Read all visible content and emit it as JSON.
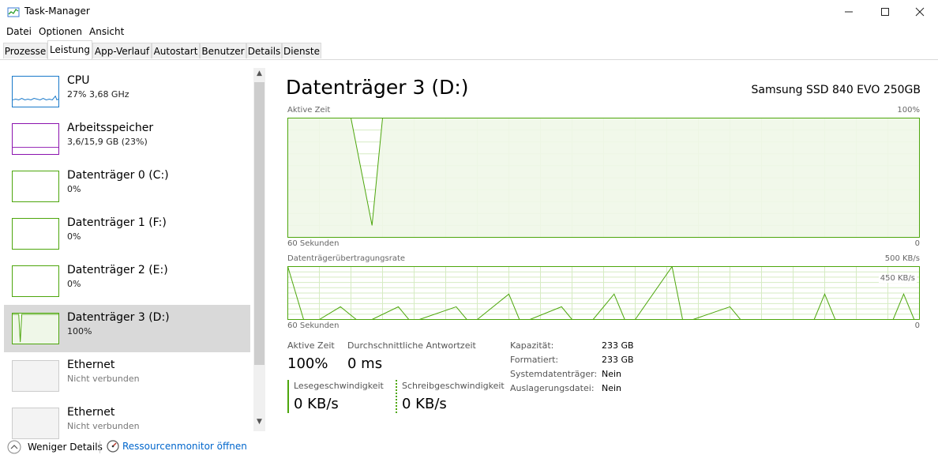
{
  "window": {
    "title": "Task-Manager"
  },
  "menu": [
    "Datei",
    "Optionen",
    "Ansicht"
  ],
  "tabs": [
    "Prozesse",
    "Leistung",
    "App-Verlauf",
    "Autostart",
    "Benutzer",
    "Details",
    "Dienste"
  ],
  "active_tab": "Leistung",
  "sidebar": [
    {
      "name": "CPU",
      "sub": "27% 3,68 GHz",
      "color": "#1979ca"
    },
    {
      "name": "Arbeitsspeicher",
      "sub": "3,6/15,9 GB (23%)",
      "color": "#8b12ae"
    },
    {
      "name": "Datenträger 0 (C:)",
      "sub": "0%",
      "color": "#4da60c"
    },
    {
      "name": "Datenträger 1 (F:)",
      "sub": "0%",
      "color": "#4da60c"
    },
    {
      "name": "Datenträger 2 (E:)",
      "sub": "0%",
      "color": "#4da60c"
    },
    {
      "name": "Datenträger 3 (D:)",
      "sub": "100%",
      "color": "#4da60c"
    },
    {
      "name": "Ethernet",
      "sub": "Nicht verbunden",
      "color": "#cccccc"
    },
    {
      "name": "Ethernet",
      "sub": "Nicht verbunden",
      "color": "#cccccc"
    }
  ],
  "main": {
    "title": "Datenträger 3 (D:)",
    "model": "Samsung SSD 840 EVO 250GB",
    "chart1": {
      "label": "Aktive Zeit",
      "max": "100%",
      "left_bottom": "60 Sekunden",
      "right_bottom": "0"
    },
    "chart2": {
      "label": "Datenträgerübertragungsrate",
      "max": "500 KB/s",
      "inner": "450 KB/s",
      "left_bottom": "60 Sekunden",
      "right_bottom": "0"
    },
    "stats": {
      "active_label": "Aktive Zeit",
      "active_value": "100%",
      "response_label": "Durchschnittliche Antwortzeit",
      "response_value": "0 ms",
      "read_label": "Lesegeschwindigkeit",
      "read_value": "0 KB/s",
      "write_label": "Schreibgeschwindigkeit",
      "write_value": "0 KB/s"
    },
    "props": [
      {
        "key": "Kapazität:",
        "value": "233 GB"
      },
      {
        "key": "Formatiert:",
        "value": "233 GB"
      },
      {
        "key": "Systemdatenträger:",
        "value": "Nein"
      },
      {
        "key": "Auslagerungsdatei:",
        "value": "Nein"
      }
    ]
  },
  "footer": {
    "less_details": "Weniger Details",
    "resource_monitor": "Ressourcenmonitor öffnen"
  },
  "colors": {
    "disk": "#4da60c",
    "disk_fill": "#eff7e8",
    "grid": "#d6ebc3",
    "link": "#0066cc"
  },
  "chart_data": [
    {
      "type": "area",
      "title": "Aktive Zeit",
      "xlabel": "60 Sekunden",
      "ylim": [
        0,
        100
      ],
      "x": [
        60,
        55,
        54,
        52,
        51,
        46,
        0
      ],
      "values": [
        100,
        100,
        100,
        10,
        100,
        100,
        100
      ]
    },
    {
      "type": "line",
      "title": "Datenträgerübertragungsrate",
      "xlabel": "60 Sekunden",
      "ylim": [
        0,
        500
      ],
      "x": [
        60,
        58.5,
        57,
        55,
        53.5,
        52,
        49.5,
        48.5,
        47.5,
        44,
        43,
        42,
        39,
        38,
        37,
        34,
        33,
        32,
        31,
        29,
        28,
        27,
        23.5,
        22.5,
        21.5,
        18,
        17,
        16,
        14,
        13,
        12,
        10,
        9,
        8,
        6,
        5,
        4,
        2.5,
        1.5,
        0.5,
        0
      ],
      "values": [
        500,
        0,
        0,
        120,
        0,
        0,
        120,
        0,
        0,
        120,
        0,
        0,
        240,
        0,
        0,
        120,
        0,
        0,
        0,
        240,
        0,
        0,
        500,
        0,
        0,
        120,
        0,
        0,
        0,
        0,
        0,
        0,
        240,
        0,
        0,
        0,
        0,
        0,
        240,
        0,
        0
      ]
    }
  ]
}
